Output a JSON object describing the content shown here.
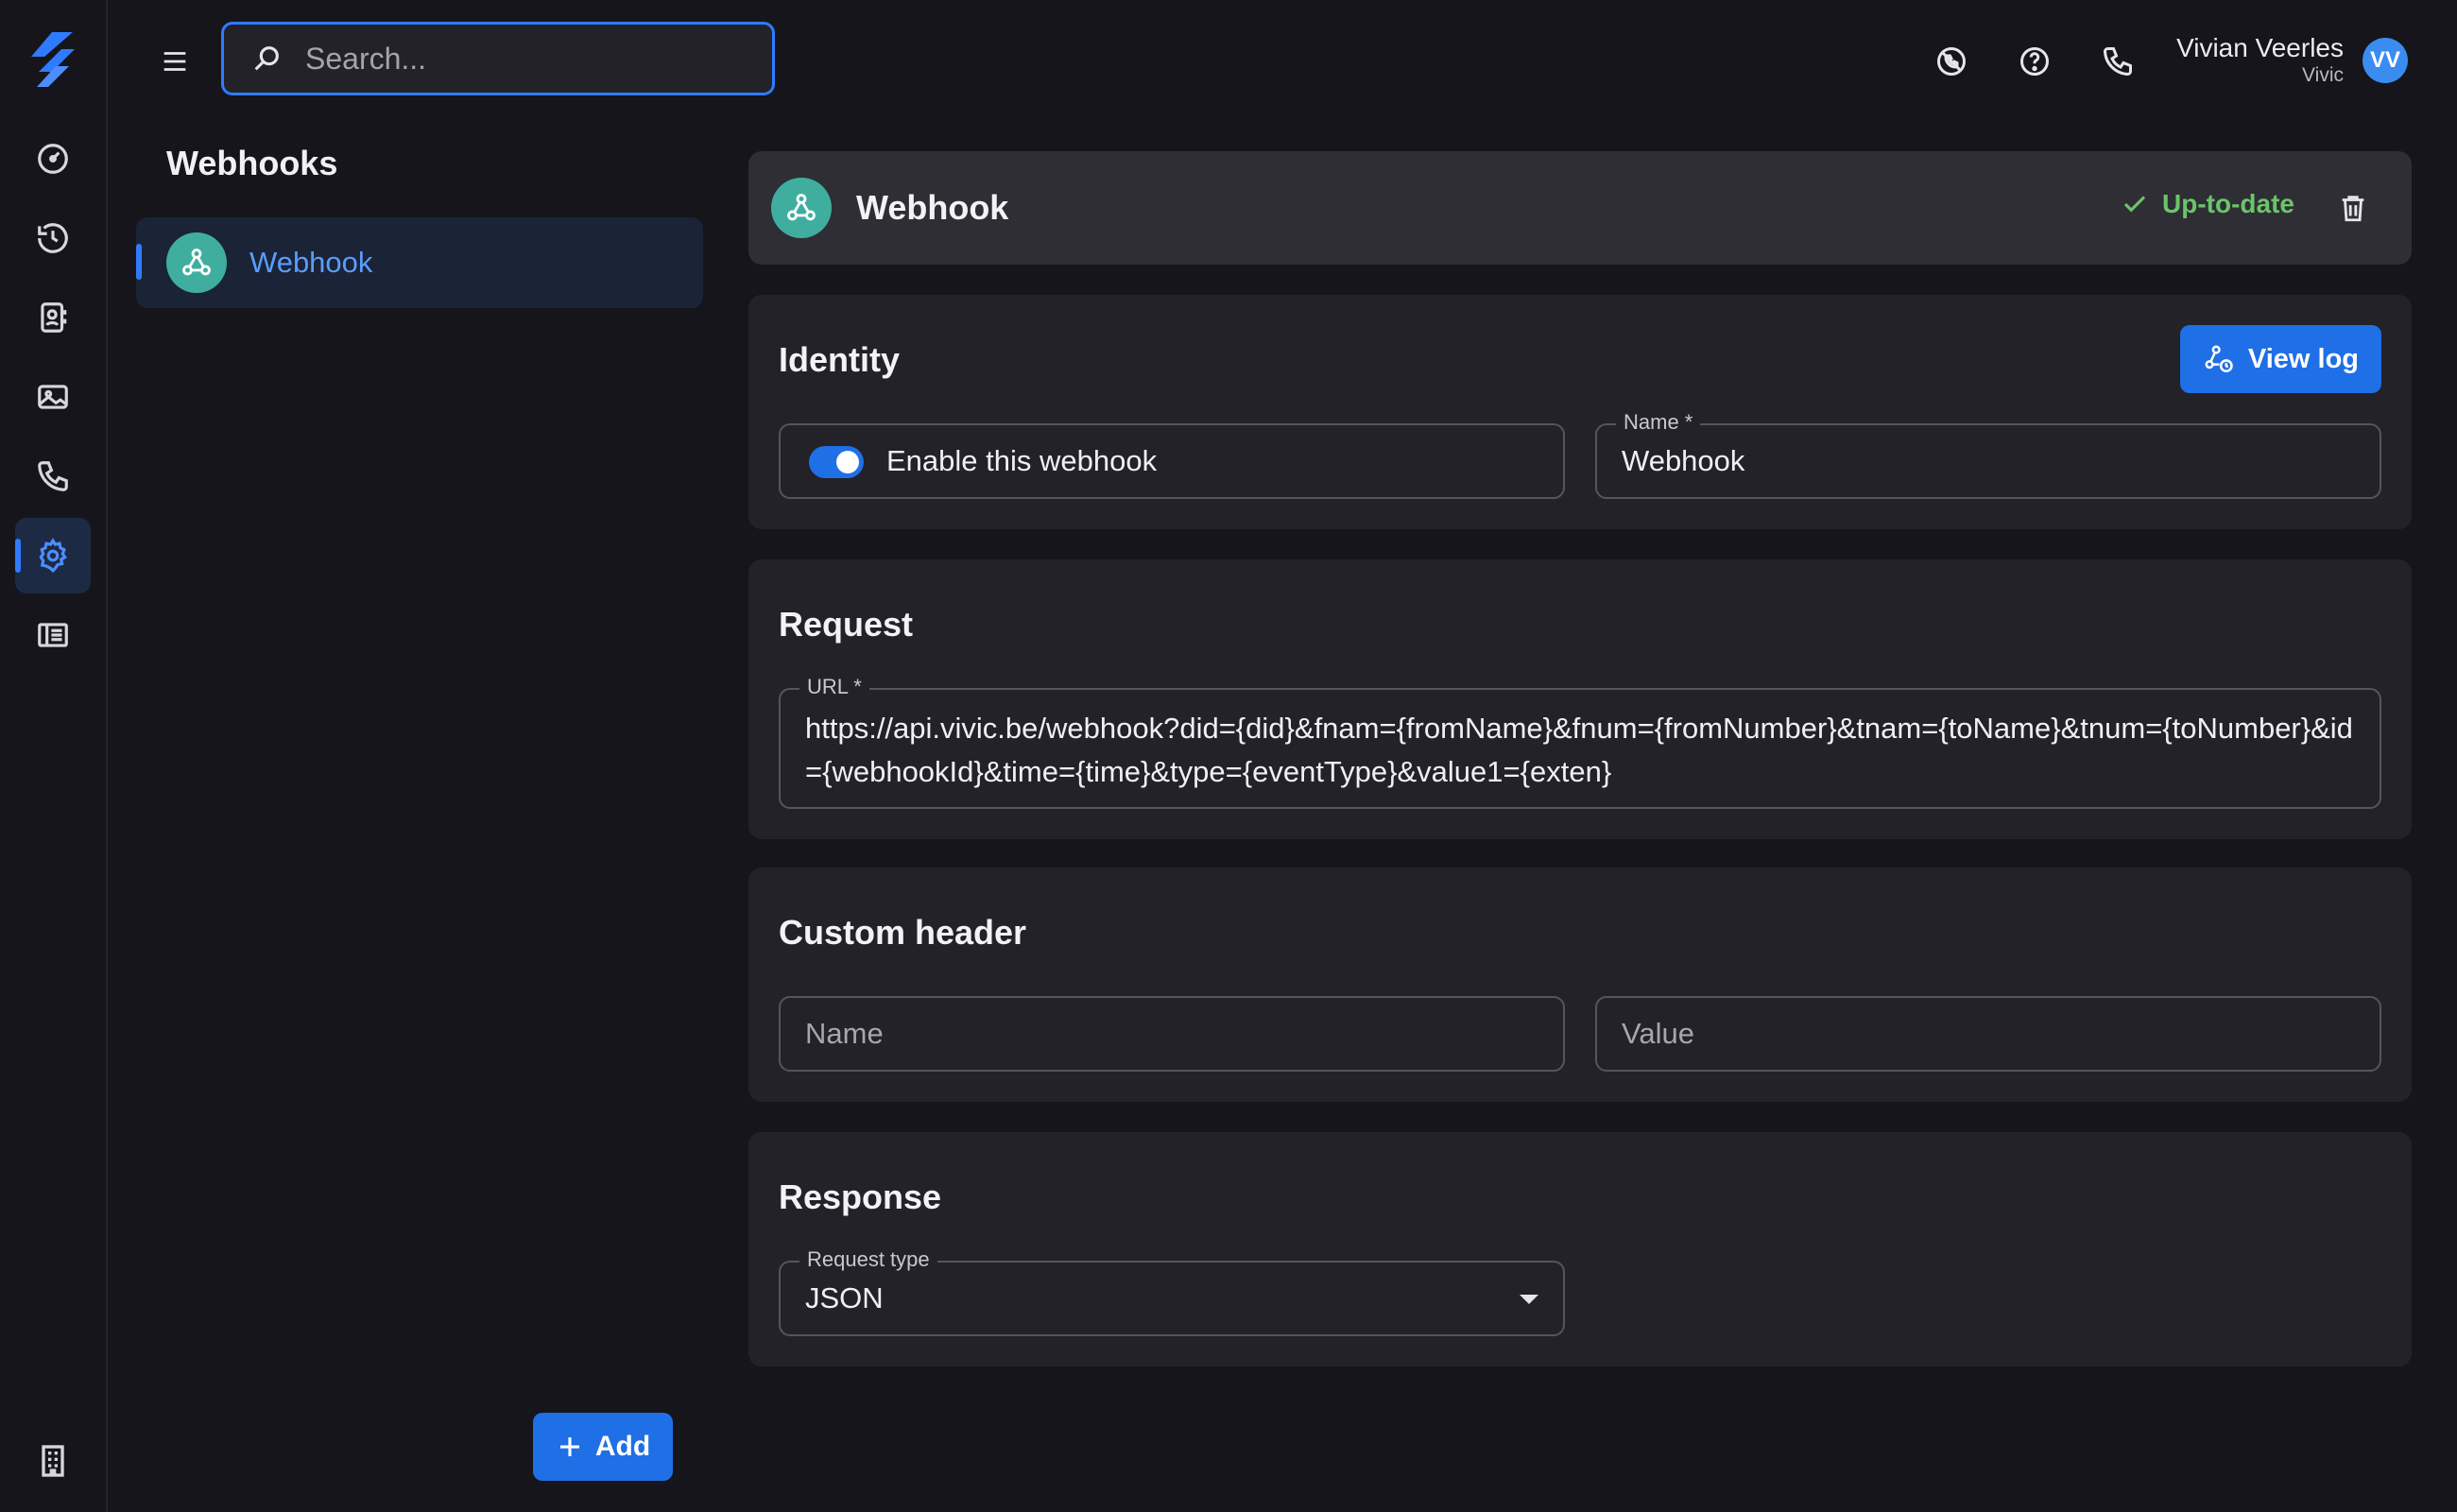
{
  "search": {
    "placeholder": "Search..."
  },
  "user": {
    "name": "Vivian Veerles",
    "org": "Vivic",
    "initials": "VV"
  },
  "topbar_icons": [
    "no-calls-icon",
    "help-icon",
    "phone-icon"
  ],
  "rail_items": [
    "dashboard-icon",
    "history-icon",
    "contacts-icon",
    "media-icon",
    "phone-icon",
    "settings-icon",
    "reports-icon"
  ],
  "sidebar": {
    "title": "Webhooks",
    "items": [
      {
        "label": "Webhook"
      }
    ],
    "add_label": "Add"
  },
  "header": {
    "title": "Webhook",
    "status": "Up-to-date"
  },
  "identity": {
    "title": "Identity",
    "view_log_label": "View log",
    "enable_label": "Enable this webhook",
    "enabled": true,
    "name_label": "Name *",
    "name_value": "Webhook"
  },
  "request": {
    "title": "Request",
    "url_label": "URL *",
    "url_value": "https://api.vivic.be/webhook?did={did}&fnam={fromName}&fnum={fromNumber}&tnam={toName}&tnum={toNumber}&id={webhookId}&time={time}&type={eventType}&value1={exten}"
  },
  "custom_header": {
    "title": "Custom header",
    "name_placeholder": "Name",
    "value_placeholder": "Value"
  },
  "response": {
    "title": "Response",
    "request_type_label": "Request type",
    "request_type_value": "JSON"
  },
  "colors": {
    "accent": "#2f7bff",
    "success": "#6bc46b",
    "webhook_badge": "#3fae9f",
    "background": "#15151b",
    "card": "#222228"
  }
}
